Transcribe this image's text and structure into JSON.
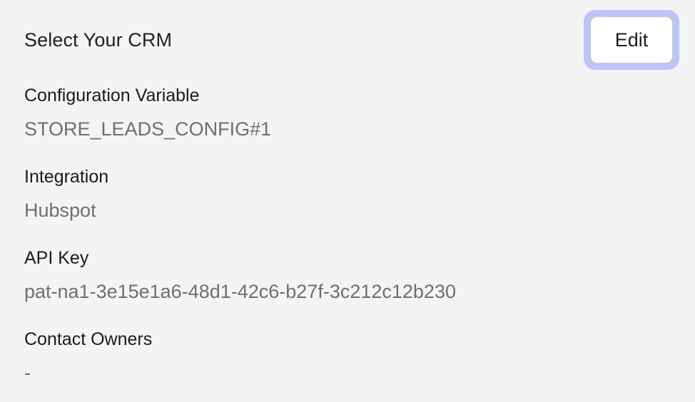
{
  "header": {
    "title": "Select Your CRM",
    "edit_label": "Edit"
  },
  "fields": [
    {
      "label": "Configuration Variable",
      "value": "STORE_LEADS_CONFIG#1"
    },
    {
      "label": "Integration",
      "value": "Hubspot"
    },
    {
      "label": "API Key",
      "value": "pat-na1-3e15e1a6-48d1-42c6-b27f-3c212c12b230"
    },
    {
      "label": "Contact Owners",
      "value": "-"
    }
  ],
  "colors": {
    "background": "#f4f4f4",
    "focus_ring": "#b9c6f7",
    "value_text": "#6f6f6f"
  }
}
